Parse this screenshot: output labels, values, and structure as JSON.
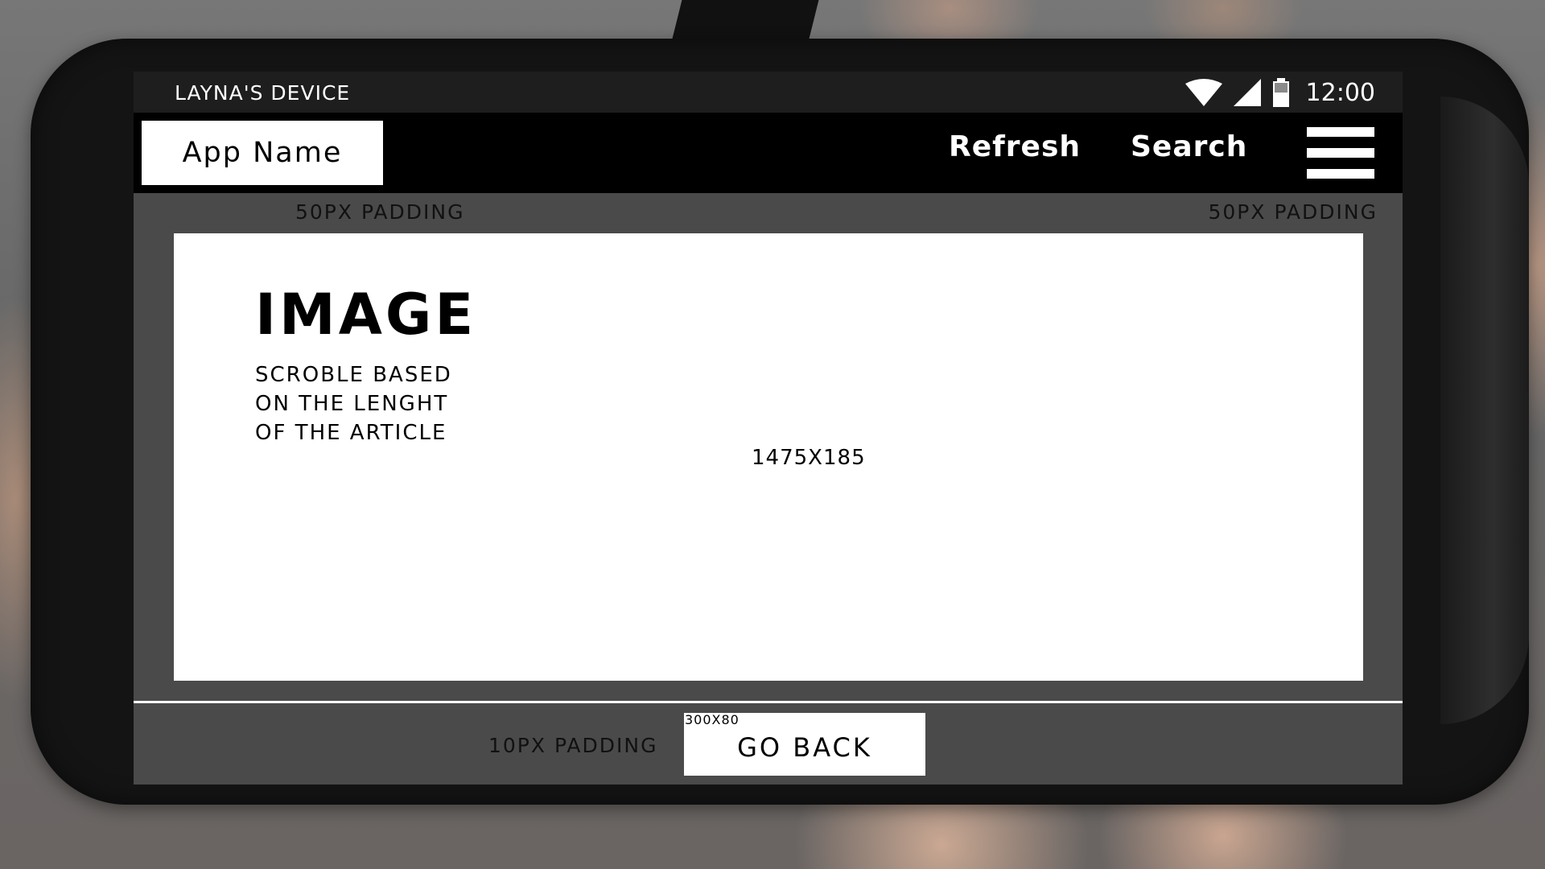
{
  "status_bar": {
    "device_name": "LAYNA'S DEVICE",
    "time": "12:00",
    "icons": [
      "wifi-icon",
      "signal-icon",
      "battery-icon"
    ]
  },
  "app_bar": {
    "app_name": "App Name",
    "actions": [
      "Refresh",
      "Search"
    ],
    "menu_icon": "hamburger-menu-icon"
  },
  "annotations": {
    "padding_top_left": "50PX PADDING",
    "padding_top_right": "50PX PADDING",
    "padding_bottom": "10PX PADDING"
  },
  "content": {
    "title": "IMAGE",
    "description_lines": [
      "SCROBLE BASED",
      "ON THE LENGHT",
      "OF THE ARTICLE"
    ],
    "size_label": "1475X185"
  },
  "footer": {
    "button_label": "GO BACK",
    "button_size": "300X80"
  },
  "colors": {
    "status_bar": "#1e1e1e",
    "app_bar": "#000000",
    "screen_background": "#4a4a4a",
    "content_background": "#ffffff",
    "text_light": "#ffffff",
    "text_dark": "#000000"
  }
}
